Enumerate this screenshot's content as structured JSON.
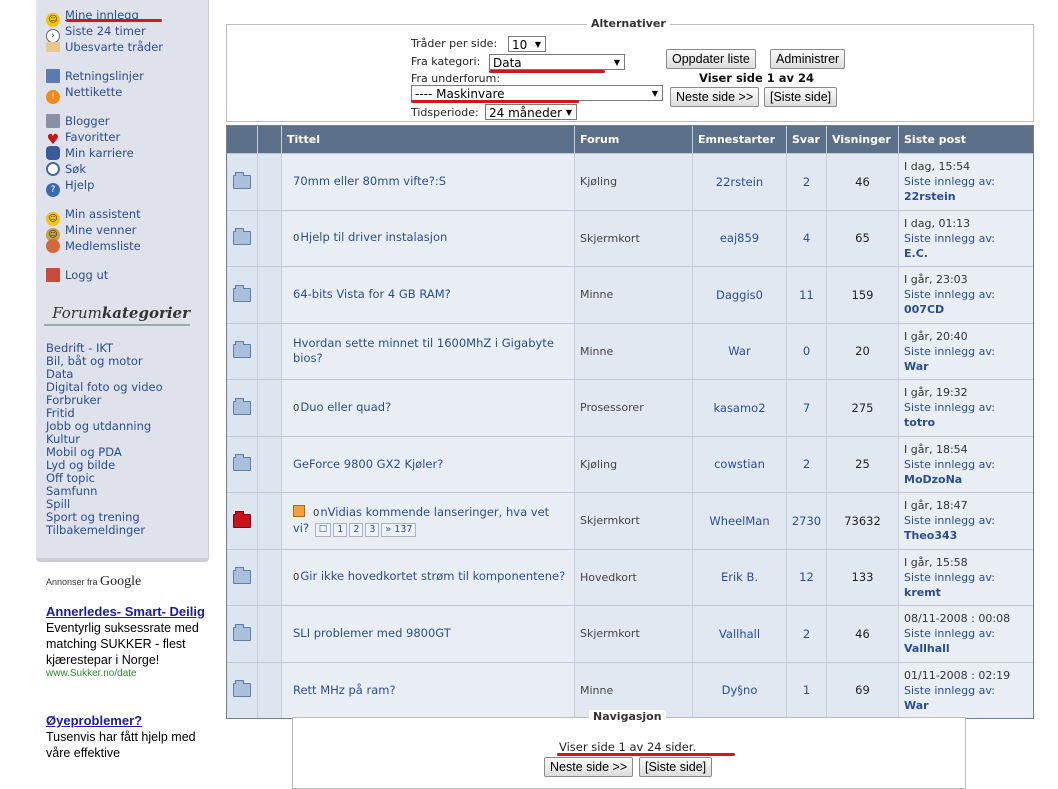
{
  "sidebar": {
    "nav": [
      {
        "label": "Mine innlegg",
        "icon": "smiley-icon"
      },
      {
        "label": "Siste 24 timer",
        "icon": "clock-arrow-icon"
      },
      {
        "label": "Ubesvarte tråder",
        "icon": "envelope-icon"
      },
      {
        "label": "Retningslinjer",
        "icon": "rules-icon"
      },
      {
        "label": "Nettikette",
        "icon": "warning-icon"
      },
      {
        "label": "Blogger",
        "icon": "blog-icon"
      },
      {
        "label": "Favoritter",
        "icon": "heart-icon"
      },
      {
        "label": "Min karriere",
        "icon": "footprints-icon"
      },
      {
        "label": "Søk",
        "icon": "magnifier-icon"
      },
      {
        "label": "Hjelp",
        "icon": "help-icon"
      },
      {
        "label": "Min assistent",
        "icon": "assistant-icon"
      },
      {
        "label": "Mine venner",
        "icon": "friends-icon"
      },
      {
        "label": "Medlemsliste",
        "icon": "members-icon"
      },
      {
        "label": "Logg ut",
        "icon": "logout-icon"
      }
    ],
    "category_heading_plain": "Forum",
    "category_heading_bold": "kategorier",
    "categories": [
      "Bedrift - IKT",
      "Bil, båt og motor",
      "Data",
      "Digital foto og video",
      "Forbruker",
      "Fritid",
      "Jobb og utdanning",
      "Kultur",
      "Mobil og PDA",
      "Lyd og bilde",
      "Off topic",
      "Samfunn",
      "Spill",
      "Sport og trening",
      "Tilbakemeldinger"
    ]
  },
  "ads": {
    "header_prefix": "Annonser fra",
    "header_brand": "Google",
    "items": [
      {
        "title": "Annerledes- Smart- Deilig",
        "text": "Eventyrlig suksessrate med matching SUKKER - flest kjærestepar i Norge!",
        "url": "www.Sukker.no/date"
      },
      {
        "title": "Øyeproblemer?",
        "text": "Tusenvis har fått hjelp med våre effektive",
        "url": ""
      }
    ]
  },
  "options": {
    "legend": "Alternativer",
    "threads_per_page_label": "Tråder per side:",
    "threads_per_page_value": "10",
    "category_label": "Fra kategori:",
    "category_value": "Data",
    "subforum_label": "Fra underforum:",
    "subforum_value": "---- Maskinvare",
    "period_label": "Tidsperiode:",
    "period_value": "24 måneder",
    "update_button": "Oppdater liste",
    "admin_button": "Administrer",
    "page_info": "Viser side 1 av 24",
    "next_button": "Neste side >>",
    "last_button": "[Siste side]"
  },
  "table": {
    "headers": {
      "title": "Tittel",
      "forum": "Forum",
      "starter": "Emnestarter",
      "replies": "Svar",
      "views": "Visninger",
      "last": "Siste post"
    },
    "last_post_prefix": "Siste innlegg av:",
    "rows": [
      {
        "title": "70mm eller 80mm vifte?:S",
        "forum": "Kjøling",
        "starter": "22rstein",
        "replies": "2",
        "views": "46",
        "date": "I dag, 15:54",
        "user": "22rstein"
      },
      {
        "title": "Hjelp til driver instalasjon",
        "prefix": "0",
        "forum": "Skjermkort",
        "starter": "eaj859",
        "replies": "4",
        "views": "65",
        "date": "I dag, 01:13",
        "user": "E.C."
      },
      {
        "title": "64-bits Vista for 4 GB RAM?",
        "forum": "Minne",
        "starter": "Daggis0",
        "replies": "11",
        "views": "159",
        "date": "I går, 23:03",
        "user": "007CD"
      },
      {
        "title": "Hvordan sette minnet til 1600MhZ i Gigabyte bios?",
        "forum": "Minne",
        "starter": "War",
        "replies": "0",
        "views": "20",
        "date": "I går, 20:40",
        "user": "War"
      },
      {
        "title": "Duo eller quad?",
        "prefix": "0",
        "forum": "Prosessorer",
        "starter": "kasamo2",
        "replies": "7",
        "views": "275",
        "date": "I går, 19:32",
        "user": "totro"
      },
      {
        "title": "GeForce 9800 GX2 Kjøler?",
        "forum": "Kjøling",
        "starter": "cowstian",
        "replies": "2",
        "views": "25",
        "date": "I går, 18:54",
        "user": "MoDzoNa"
      },
      {
        "title": "nVidias kommende lanseringer, hva vet vi?",
        "prefix": "0",
        "forum": "Skjermkort",
        "starter": "WheelMan",
        "replies": "2730",
        "views": "73632",
        "date": "I går, 18:47",
        "user": "Theo343",
        "hot": true,
        "pages": [
          "1",
          "2",
          "3",
          "» 137"
        ]
      },
      {
        "title": "Gir ikke hovedkortet strøm til komponentene?",
        "prefix": "0",
        "forum": "Hovedkort",
        "starter": "Erik B.",
        "replies": "12",
        "views": "133",
        "date": "I går, 15:58",
        "user": "kremt"
      },
      {
        "title": "SLI problemer med 9800GT",
        "forum": "Skjermkort",
        "starter": "Vallhall",
        "replies": "2",
        "views": "46",
        "date": "08/11-2008 : 00:08",
        "user": "Vallhall"
      },
      {
        "title": "Rett MHz på ram?",
        "forum": "Minne",
        "starter": "Dy§no",
        "replies": "1",
        "views": "69",
        "date": "01/11-2008 : 02:19",
        "user": "War"
      }
    ]
  },
  "navigation": {
    "legend": "Navigasjon",
    "info": "Viser side 1 av 24 sider.",
    "next_button": "Neste side >>",
    "last_button": "[Siste side]"
  },
  "colors": {
    "annotation_underline": "#d01818",
    "header_bg": "#5c7189",
    "link": "#2b4d8f"
  }
}
